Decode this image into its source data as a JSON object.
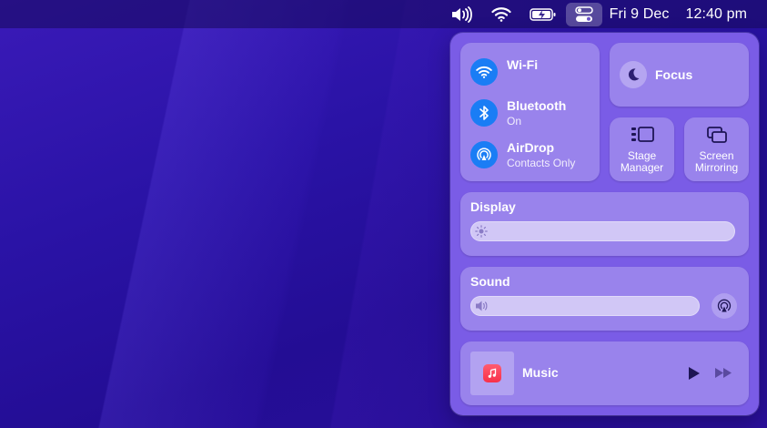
{
  "menubar": {
    "date": "Fri 9 Dec",
    "time": "12:40 pm",
    "icons": [
      "speaker-icon",
      "wifi-icon",
      "battery-charging-icon",
      "control-center-icon"
    ]
  },
  "control_center": {
    "wifi": {
      "label": "Wi-Fi"
    },
    "bluetooth": {
      "label": "Bluetooth",
      "status": "On"
    },
    "airdrop": {
      "label": "AirDrop",
      "status": "Contacts Only"
    },
    "focus": {
      "label": "Focus"
    },
    "stage_manager": {
      "line1": "Stage",
      "line2": "Manager"
    },
    "screen_mirroring": {
      "line1": "Screen",
      "line2": "Mirroring"
    },
    "display": {
      "label": "Display",
      "brightness": 1.0
    },
    "sound": {
      "label": "Sound",
      "volume": 1.0
    },
    "music": {
      "label": "Music"
    }
  },
  "colors": {
    "accent": "#1a7df5",
    "panel": "#7a5ce6",
    "music_icon": "#f8304a"
  }
}
